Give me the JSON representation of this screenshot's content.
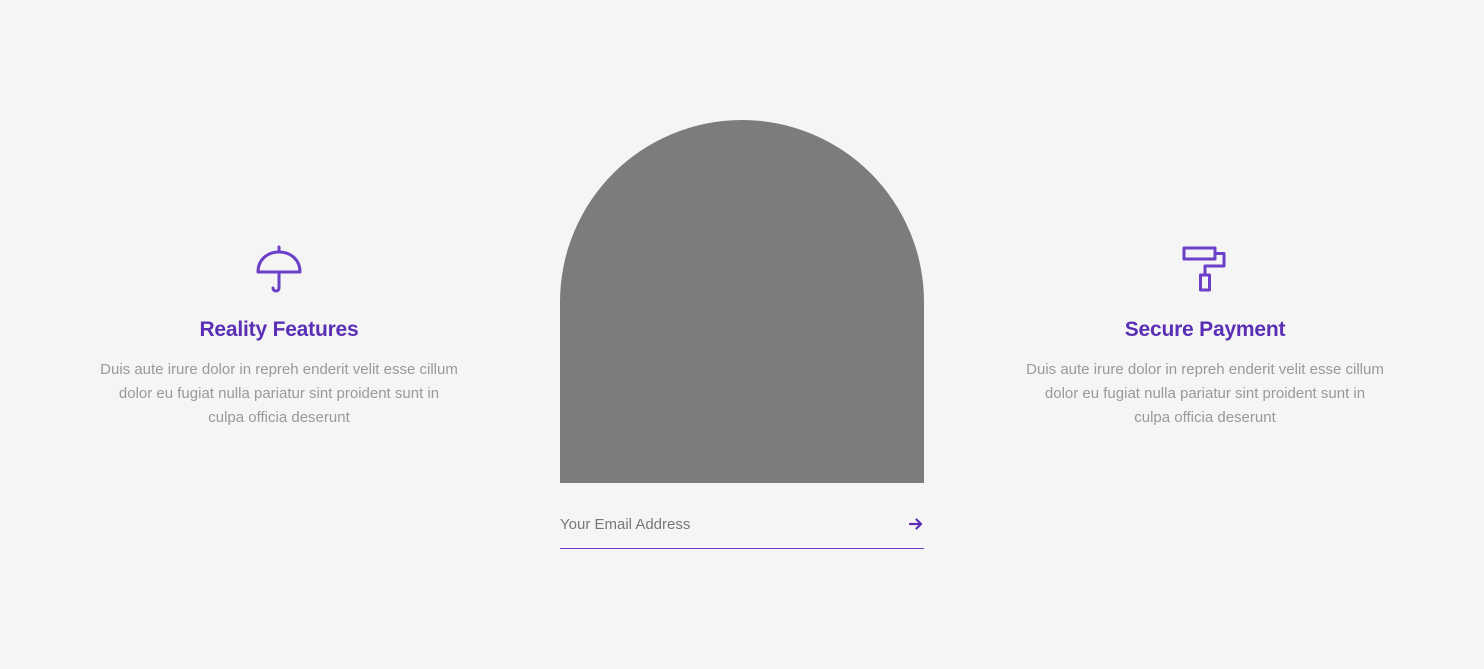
{
  "features": [
    {
      "icon": "umbrella-icon",
      "title": "Reality Features",
      "description": "Duis aute irure dolor in repreh enderit velit esse cillum dolor eu fugiat nulla pariatur sint proident sunt in culpa officia deserunt"
    },
    {
      "icon": "paint-roller-icon",
      "title": "Secure Payment",
      "description": "Duis aute irure dolor in repreh enderit velit esse cillum dolor eu fugiat nulla pariatur sint proident sunt in culpa officia deserunt"
    }
  ],
  "subscribe": {
    "placeholder": "Your Email Address",
    "submit_icon": "arrow-right-icon"
  },
  "colors": {
    "accent": "#6b3fc7",
    "title": "#5b2fb5",
    "text_muted": "#999999",
    "image_placeholder": "#7b7c7d",
    "background": "#f5f5f5"
  }
}
